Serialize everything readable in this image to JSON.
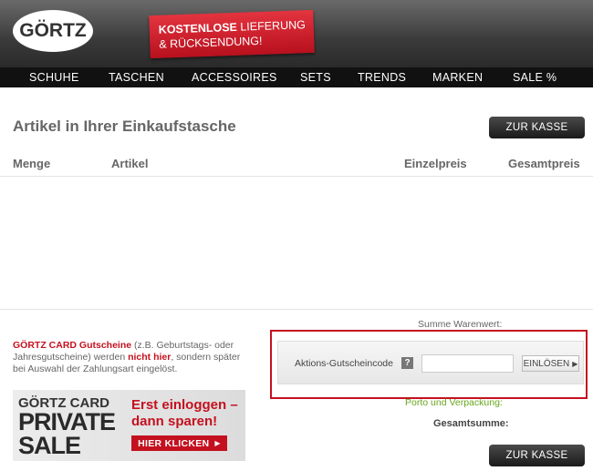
{
  "header": {
    "logo": "GÖRTZ",
    "promo_line1_bold": "KOSTENLOSE",
    "promo_line1_rest": " LIEFERUNG",
    "promo_line2": "& RÜCKSENDUNG!"
  },
  "nav": {
    "items": [
      "SCHUHE",
      "TASCHEN",
      "ACCESSOIRES",
      "SETS",
      "TRENDS",
      "MARKEN",
      "SALE %"
    ]
  },
  "cart": {
    "title": "Artikel in Ihrer Einkaufstasche",
    "checkout_label": "ZUR KASSE",
    "columns": [
      "Menge",
      "Artikel",
      "Einzelpreis",
      "Gesamtpreis"
    ]
  },
  "card_info": {
    "brand_text": "GÖRTZ CARD Gutscheine",
    "part1": " (z.B. Geburtstags- oder Jahresgutscheine) werden ",
    "emphasis": "nicht hier",
    "part2": ", sondern später bei Auswahl der Zahlungsart eingelöst."
  },
  "banner": {
    "line1": "GÖRTZ CARD",
    "line2": "PRIVATE",
    "line3": "SALE",
    "cta_text": "Erst einloggen – dann sparen!",
    "button_label": "HIER KLICKEN"
  },
  "summary": {
    "subtotal_label": "Summe Warenwert:",
    "coupon_label": "Aktions-Gutscheincode",
    "help_symbol": "?",
    "coupon_value": "",
    "redeem_label": "EINLÖSEN",
    "shipping_label": "Porto und Verpackung:",
    "total_label": "Gesamtsumme:",
    "checkout_label": "ZUR KASSE"
  },
  "colors": {
    "brand_red": "#c4111f",
    "nav_bg": "#111111",
    "shipping_green": "#6aa61e"
  }
}
